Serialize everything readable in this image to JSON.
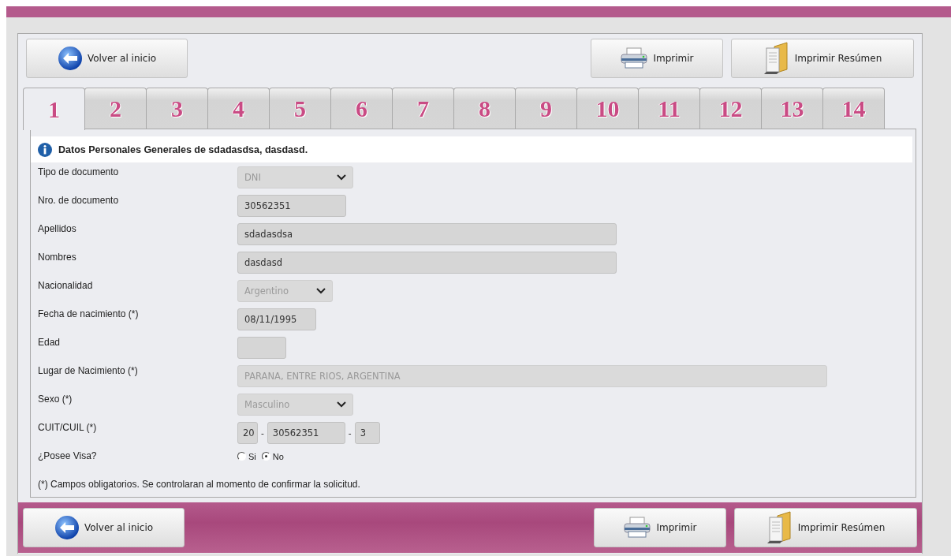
{
  "top_buttons": [
    {
      "label": "Volver al inicio",
      "kind": "back"
    },
    {
      "label": "Imprimir",
      "kind": "print"
    },
    {
      "label": "Imprimir Resúmen",
      "kind": "summary"
    }
  ],
  "tabs": [
    {
      "label": "1",
      "selected": true
    },
    {
      "label": "2",
      "selected": false
    },
    {
      "label": "3",
      "selected": false
    },
    {
      "label": "4",
      "selected": false
    },
    {
      "label": "5",
      "selected": false
    },
    {
      "label": "6",
      "selected": false
    },
    {
      "label": "7",
      "selected": false
    },
    {
      "label": "8",
      "selected": false
    },
    {
      "label": "9",
      "selected": false
    },
    {
      "label": "10",
      "selected": false
    },
    {
      "label": "11",
      "selected": false
    },
    {
      "label": "12",
      "selected": false
    },
    {
      "label": "13",
      "selected": false
    },
    {
      "label": "14",
      "selected": false
    }
  ],
  "section_title": "Datos Personales Generales de sdadasdsa, dasdasd.",
  "fields": [
    {
      "label": "Tipo de documento",
      "kind": "select",
      "value": "DNI",
      "disabled": true
    },
    {
      "label": "Nro. de documento",
      "kind": "text",
      "value": "30562351",
      "disabled": false
    },
    {
      "label": "Apellidos",
      "kind": "text",
      "value": "sdadasdsa",
      "disabled": false
    },
    {
      "label": "Nombres",
      "kind": "text",
      "value": "dasdasd",
      "disabled": false
    },
    {
      "label": "Nacionalidad",
      "kind": "select",
      "value": "Argentino",
      "disabled": true
    },
    {
      "label": "Fecha de nacimiento (*)",
      "kind": "text",
      "value": "08/11/1995",
      "disabled": false
    },
    {
      "label": "Edad",
      "kind": "text",
      "disabled": false
    },
    {
      "label": "Lugar de Nacimiento (*)",
      "kind": "text",
      "value": "PARANA, ENTRE RIOS, ARGENTINA",
      "disabled": true
    },
    {
      "label": "Sexo (*)",
      "kind": "select",
      "value": "Masculino",
      "disabled": true
    },
    {
      "label": "CUIT/CUIL (*)",
      "kind": "cuit",
      "parts": [
        "20",
        "30562351",
        "3"
      ],
      "separators": [
        "-",
        "-"
      ]
    },
    {
      "label": "¿Posee Visa?",
      "kind": "radio",
      "options": [
        {
          "label": "Si",
          "selected": false
        },
        {
          "label": "No",
          "selected": true
        }
      ]
    }
  ],
  "note": "(*) Campos obligatorios. Se controlaran al momento de confirmar la solicitud.",
  "bottom_buttons": [
    {
      "label": "Volver al inicio",
      "kind": "back"
    },
    {
      "label": "Imprimir",
      "kind": "print"
    },
    {
      "label": "Imprimir Resúmen",
      "kind": "summary"
    }
  ]
}
